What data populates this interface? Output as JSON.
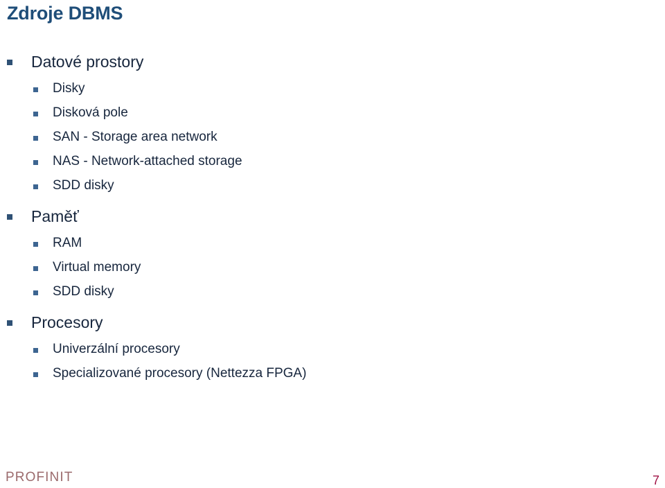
{
  "slide": {
    "title": "Zdroje DBMS",
    "title_color": "#1F4E79",
    "body_color": "#17263D",
    "background_color": "#FFFFFF",
    "bullets": [
      {
        "level": 1,
        "text": "Datové prostory"
      },
      {
        "level": 2,
        "text": "Disky"
      },
      {
        "level": 2,
        "text": "Disková pole"
      },
      {
        "level": 2,
        "text": "SAN - Storage area network"
      },
      {
        "level": 2,
        "text": "NAS - Network-attached storage"
      },
      {
        "level": 2,
        "text": "SDD disky"
      },
      {
        "level": 1,
        "text": "Paměť"
      },
      {
        "level": 2,
        "text": "RAM"
      },
      {
        "level": 2,
        "text": "Virtual memory"
      },
      {
        "level": 2,
        "text": "SDD disky"
      },
      {
        "level": 1,
        "text": "Procesory"
      },
      {
        "level": 2,
        "text": "Univerzální procesory"
      },
      {
        "level": 2,
        "text": "Specializované procesory (Nettezza FPGA)"
      }
    ]
  },
  "footer": {
    "logo_text": "PROFINIT",
    "logo_color": "#9B6A6C",
    "page_number": "7",
    "page_number_color": "#A01346"
  }
}
